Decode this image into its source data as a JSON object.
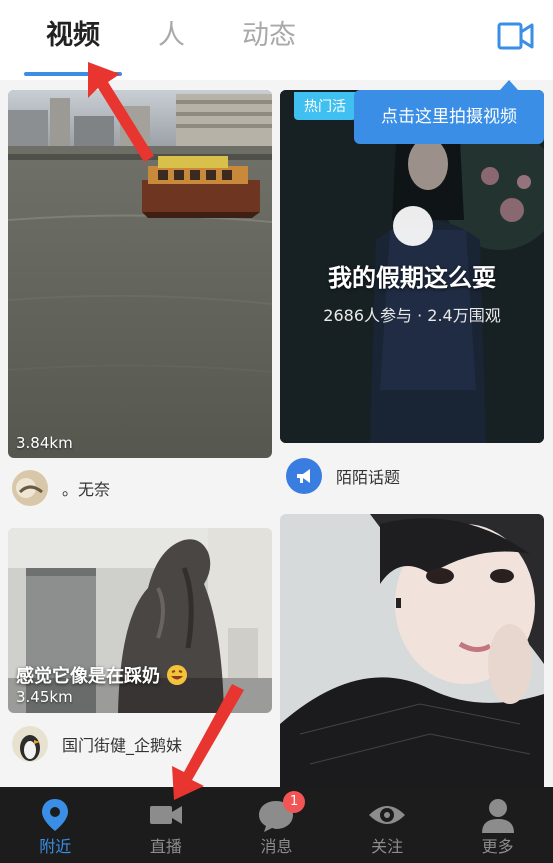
{
  "top_tabs": [
    {
      "label": "视频",
      "active": true
    },
    {
      "label": "人",
      "active": false
    },
    {
      "label": "动态",
      "active": false
    }
  ],
  "camera_icon": "video-camera-icon",
  "tooltip": "点击这里拍摄视频",
  "cards": {
    "card1": {
      "distance": "3.84km",
      "user": "。无奈"
    },
    "card2": {
      "badge": "热门活",
      "title": "我的假期这么耍",
      "stats": "2686人参与 · 2.4万围观",
      "footer": "陌陌话题"
    },
    "card3": {
      "caption": "感觉它像是在踩奶",
      "distance": "3.45km",
      "user": "国门街健_企鹅妹"
    }
  },
  "bottom_nav": [
    {
      "label": "附近",
      "icon": "location-pin-icon",
      "active": true
    },
    {
      "label": "直播",
      "icon": "video-camera-icon",
      "active": false
    },
    {
      "label": "消息",
      "icon": "chat-bubble-icon",
      "active": false,
      "badge": "1"
    },
    {
      "label": "关注",
      "icon": "eye-icon",
      "active": false
    },
    {
      "label": "更多",
      "icon": "person-icon",
      "active": false
    }
  ],
  "colors": {
    "accent": "#3a8ee6",
    "badge": "#f25555",
    "nav_bg": "#1c1c1c",
    "annotation_arrow": "#e8352f"
  }
}
